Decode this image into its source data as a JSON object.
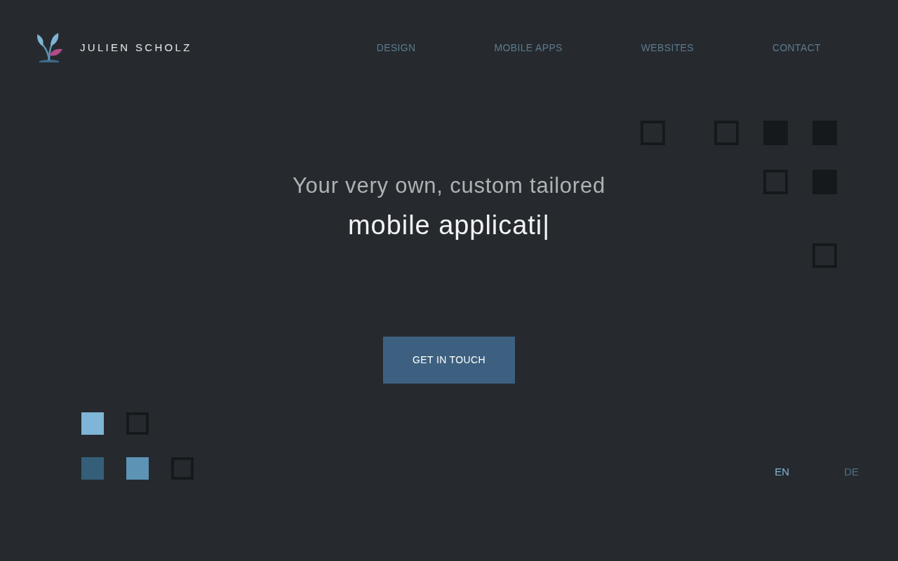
{
  "brand": {
    "name": "JULIEN SCHOLZ"
  },
  "nav": [
    {
      "label": "DESIGN"
    },
    {
      "label": "MOBILE APPS"
    },
    {
      "label": "WEBSITES"
    },
    {
      "label": "CONTACT"
    }
  ],
  "hero": {
    "tagline": "Your very own, custom tailored",
    "typed": "mobile applicati|",
    "button": "GET IN TOUCH"
  },
  "decor_top": [
    [
      {
        "kind": "outline"
      },
      {
        "kind": "empty"
      },
      {
        "kind": "empty"
      },
      {
        "kind": "outline"
      },
      {
        "kind": "empty"
      },
      {
        "kind": "filled",
        "color": "#16191b"
      },
      {
        "kind": "empty"
      },
      {
        "kind": "filled",
        "color": "#16191b"
      }
    ],
    [
      {
        "kind": "empty"
      },
      {
        "kind": "empty"
      },
      {
        "kind": "empty"
      },
      {
        "kind": "empty"
      },
      {
        "kind": "empty"
      },
      {
        "kind": "empty"
      },
      {
        "kind": "empty"
      },
      {
        "kind": "empty"
      }
    ],
    [
      {
        "kind": "empty"
      },
      {
        "kind": "empty"
      },
      {
        "kind": "empty"
      },
      {
        "kind": "empty"
      },
      {
        "kind": "empty"
      },
      {
        "kind": "outline"
      },
      {
        "kind": "empty"
      },
      {
        "kind": "filled",
        "color": "#16191b"
      }
    ],
    [
      {
        "kind": "empty"
      },
      {
        "kind": "empty"
      },
      {
        "kind": "empty"
      },
      {
        "kind": "empty"
      },
      {
        "kind": "empty"
      },
      {
        "kind": "empty"
      },
      {
        "kind": "empty"
      },
      {
        "kind": "empty"
      }
    ],
    [
      {
        "kind": "empty"
      },
      {
        "kind": "empty"
      },
      {
        "kind": "empty"
      },
      {
        "kind": "empty"
      },
      {
        "kind": "empty"
      },
      {
        "kind": "empty"
      },
      {
        "kind": "empty"
      },
      {
        "kind": "empty"
      }
    ],
    [
      {
        "kind": "empty"
      },
      {
        "kind": "empty"
      },
      {
        "kind": "empty"
      },
      {
        "kind": "empty"
      },
      {
        "kind": "empty"
      },
      {
        "kind": "empty"
      },
      {
        "kind": "empty"
      },
      {
        "kind": "outline"
      }
    ]
  ],
  "decor_bottom": [
    [
      {
        "kind": "filled",
        "color": "#7fb5d6"
      },
      {
        "kind": "empty"
      },
      {
        "kind": "outline"
      },
      {
        "kind": "empty"
      },
      {
        "kind": "empty"
      }
    ],
    [
      {
        "kind": "empty"
      },
      {
        "kind": "empty"
      },
      {
        "kind": "empty"
      },
      {
        "kind": "empty"
      },
      {
        "kind": "empty"
      }
    ],
    [
      {
        "kind": "filled",
        "color": "#355f79"
      },
      {
        "kind": "empty"
      },
      {
        "kind": "filled",
        "color": "#5d93b5"
      },
      {
        "kind": "empty"
      },
      {
        "kind": "outline"
      }
    ]
  ],
  "languages": [
    {
      "label": "EN",
      "selected": true
    },
    {
      "label": "DE",
      "selected": false
    }
  ]
}
